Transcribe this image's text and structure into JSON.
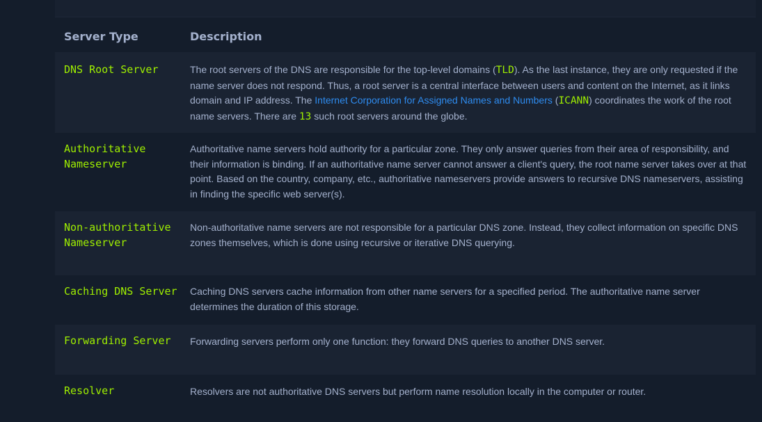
{
  "table": {
    "headers": [
      "Server Type",
      "Description"
    ],
    "rows": [
      {
        "type": "DNS Root Server",
        "desc": {
          "p1": "The root servers of the DNS are responsible for the top-level domains (",
          "code1": "TLD",
          "p2": "). As the last instance, they are only requested if the name server does not respond. Thus, a root server is a central interface between users and content on the Internet, as it links domain and IP address. The ",
          "link": "Internet Corporation for Assigned Names and Numbers",
          "p3": " (",
          "code2": "ICANN",
          "p4": ") coordinates the work of the root name servers. There are ",
          "code3": "13",
          "p5": " such root servers around the globe."
        }
      },
      {
        "type": "Authoritative Nameserver",
        "desc": "Authoritative name servers hold authority for a particular zone. They only answer queries from their area of responsibility, and their information is binding. If an authoritative name server cannot answer a client's query, the root name server takes over at that point. Based on the country, company, etc., authoritative nameservers provide answers to recursive DNS nameservers, assisting in finding the specific web server(s)."
      },
      {
        "type": "Non-authoritative Nameserver",
        "desc": "Non-authoritative name servers are not responsible for a particular DNS zone. Instead, they collect information on specific DNS zones themselves, which is done using recursive or iterative DNS querying."
      },
      {
        "type": "Caching DNS Server",
        "desc": "Caching DNS servers cache information from other name servers for a specified period. The authoritative name server determines the duration of this storage."
      },
      {
        "type": "Forwarding Server",
        "desc": "Forwarding servers perform only one function: they forward DNS queries to another DNS server."
      },
      {
        "type": "Resolver",
        "desc": "Resolvers are not authoritative DNS servers but perform name resolution locally in the computer or router."
      }
    ]
  },
  "colors": {
    "background": "#141d2b",
    "row_alt": "#1a2332",
    "accent_green": "#9fef00",
    "text": "#a4b1cd",
    "link": "#2e8cf0"
  }
}
